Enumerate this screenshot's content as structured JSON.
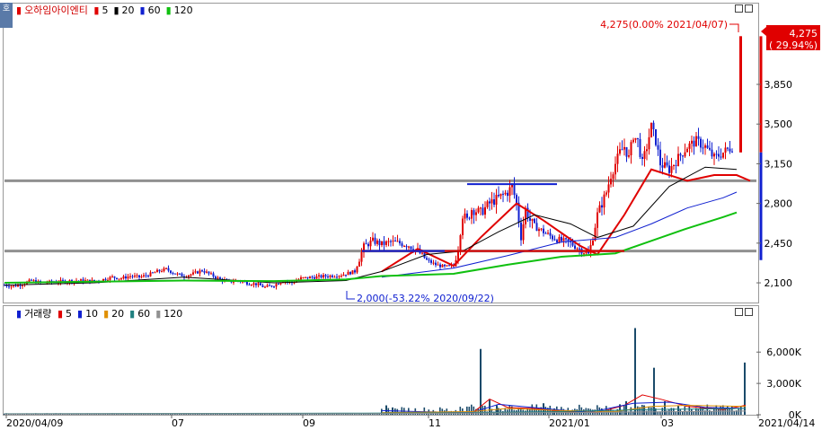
{
  "legend_price": {
    "name": "오하임아이엔티",
    "items": [
      {
        "label": "5",
        "color": "#e00000"
      },
      {
        "label": "20",
        "color": "#000000"
      },
      {
        "label": "60",
        "color": "#1020d0"
      },
      {
        "label": "120",
        "color": "#10c010"
      }
    ]
  },
  "legend_volume": {
    "name": "거래량",
    "items": [
      {
        "label": "5",
        "color": "#e00000"
      },
      {
        "label": "10",
        "color": "#1020d0"
      },
      {
        "label": "20",
        "color": "#e09000"
      },
      {
        "label": "60",
        "color": "#208080"
      },
      {
        "label": "120",
        "color": "#909090"
      }
    ]
  },
  "badge": "호",
  "chart_data": [
    {
      "type": "candlestick",
      "ylim": [
        1950,
        4420
      ],
      "y_ticks": [
        {
          "v": 2100,
          "label": "2,100"
        },
        {
          "v": 2450,
          "label": "2,450"
        },
        {
          "v": 2800,
          "label": "2,800"
        },
        {
          "v": 3150,
          "label": "3,150"
        },
        {
          "v": 3500,
          "label": "3,500"
        },
        {
          "v": 3850,
          "label": "3,850"
        }
      ],
      "last_price": {
        "label": "4,275",
        "pct": "( 29.94%)",
        "value": 4275
      },
      "annotation_high": {
        "text": "4,275(0.00% 2021/04/07)",
        "value": 4275
      },
      "annotation_low": {
        "text": "2,000(-53.22% 2020/09/22)",
        "value": 2000
      },
      "horizontal_lines": [
        {
          "value": 3000,
          "color": "#909090"
        },
        {
          "value": 2380,
          "color": "#909090"
        }
      ],
      "ohlc_path": [
        [
          0,
          2080
        ],
        [
          10,
          2070
        ],
        [
          20,
          2090
        ],
        [
          30,
          2120
        ],
        [
          40,
          2100
        ],
        [
          60,
          2110
        ],
        [
          80,
          2120
        ],
        [
          100,
          2115
        ],
        [
          110,
          2130
        ],
        [
          120,
          2150
        ],
        [
          130,
          2140
        ],
        [
          140,
          2160
        ],
        [
          150,
          2150
        ],
        [
          160,
          2170
        ],
        [
          170,
          2200
        ],
        [
          180,
          2220
        ],
        [
          190,
          2180
        ],
        [
          200,
          2160
        ],
        [
          210,
          2180
        ],
        [
          220,
          2210
        ],
        [
          230,
          2170
        ],
        [
          240,
          2130
        ],
        [
          250,
          2110
        ],
        [
          260,
          2120
        ],
        [
          270,
          2100
        ],
        [
          280,
          2090
        ],
        [
          290,
          2060
        ],
        [
          300,
          2080
        ],
        [
          310,
          2120
        ],
        [
          320,
          2100
        ],
        [
          330,
          2140
        ],
        [
          345,
          2150
        ],
        [
          360,
          2160
        ],
        [
          375,
          2170
        ],
        [
          390,
          2200
        ],
        [
          400,
          2420
        ],
        [
          410,
          2470
        ],
        [
          420,
          2440
        ],
        [
          430,
          2460
        ],
        [
          440,
          2450
        ],
        [
          450,
          2430
        ],
        [
          460,
          2380
        ],
        [
          470,
          2300
        ],
        [
          480,
          2260
        ],
        [
          490,
          2240
        ],
        [
          500,
          2250
        ],
        [
          505,
          2400
        ],
        [
          510,
          2700
        ],
        [
          515,
          2650
        ],
        [
          520,
          2750
        ],
        [
          530,
          2720
        ],
        [
          540,
          2800
        ],
        [
          550,
          2850
        ],
        [
          560,
          2900
        ],
        [
          565,
          2950
        ],
        [
          570,
          2800
        ],
        [
          575,
          2500
        ],
        [
          580,
          2750
        ],
        [
          585,
          2650
        ],
        [
          590,
          2600
        ],
        [
          600,
          2550
        ],
        [
          610,
          2500
        ],
        [
          620,
          2470
        ],
        [
          630,
          2450
        ],
        [
          640,
          2400
        ],
        [
          650,
          2350
        ],
        [
          655,
          2500
        ],
        [
          660,
          2700
        ],
        [
          665,
          2800
        ],
        [
          670,
          2900
        ],
        [
          675,
          3050
        ],
        [
          680,
          3150
        ],
        [
          685,
          3250
        ],
        [
          690,
          3300
        ],
        [
          695,
          3200
        ],
        [
          700,
          3400
        ],
        [
          705,
          3350
        ],
        [
          710,
          3150
        ],
        [
          715,
          3300
        ],
        [
          720,
          3480
        ],
        [
          725,
          3350
        ],
        [
          730,
          3150
        ],
        [
          740,
          3100
        ],
        [
          750,
          3200
        ],
        [
          760,
          3300
        ],
        [
          770,
          3350
        ],
        [
          780,
          3300
        ],
        [
          790,
          3200
        ],
        [
          800,
          3250
        ],
        [
          810,
          3300
        ],
        [
          815,
          4275
        ]
      ],
      "ma": [
        {
          "period": 5,
          "color": "#e00000",
          "points": [
            [
              420,
              2200
            ],
            [
              460,
              2400
            ],
            [
              500,
              2250
            ],
            [
              530,
              2500
            ],
            [
              570,
              2800
            ],
            [
              600,
              2650
            ],
            [
              640,
              2430
            ],
            [
              660,
              2350
            ],
            [
              690,
              2700
            ],
            [
              720,
              3100
            ],
            [
              760,
              3000
            ],
            [
              790,
              3050
            ],
            [
              815,
              3050
            ],
            [
              830,
              3000
            ]
          ]
        },
        {
          "period": 20,
          "color": "#000000",
          "points": [
            [
              0,
              2080
            ],
            [
              100,
              2100
            ],
            [
              200,
              2150
            ],
            [
              300,
              2100
            ],
            [
              380,
              2120
            ],
            [
              420,
              2200
            ],
            [
              470,
              2350
            ],
            [
              510,
              2380
            ],
            [
              550,
              2550
            ],
            [
              590,
              2700
            ],
            [
              630,
              2620
            ],
            [
              660,
              2500
            ],
            [
              700,
              2600
            ],
            [
              740,
              2950
            ],
            [
              780,
              3120
            ],
            [
              815,
              3100
            ]
          ]
        },
        {
          "period": 60,
          "color": "#1020d0",
          "points": [
            [
              420,
              2150
            ],
            [
              500,
              2230
            ],
            [
              560,
              2340
            ],
            [
              620,
              2460
            ],
            [
              680,
              2500
            ],
            [
              720,
              2620
            ],
            [
              760,
              2760
            ],
            [
              800,
              2850
            ],
            [
              815,
              2900
            ]
          ]
        },
        {
          "period": 120,
          "color": "#10c010",
          "points": [
            [
              0,
              2100
            ],
            [
              100,
              2110
            ],
            [
              200,
              2120
            ],
            [
              300,
              2115
            ],
            [
              380,
              2130
            ],
            [
              420,
              2160
            ],
            [
              500,
              2180
            ],
            [
              560,
              2260
            ],
            [
              620,
              2330
            ],
            [
              680,
              2360
            ],
            [
              720,
              2470
            ],
            [
              760,
              2580
            ],
            [
              800,
              2680
            ],
            [
              815,
              2720
            ]
          ]
        }
      ],
      "trend_lines": [
        {
          "color": "#e00000",
          "points": [
            [
              398,
              2380
            ],
            [
              690,
              2380
            ]
          ]
        },
        {
          "color": "#1020d0",
          "points": [
            [
              398,
              2380
            ],
            [
              490,
              2380
            ]
          ]
        },
        {
          "color": "#1020d0",
          "points": [
            [
              515,
              2970
            ],
            [
              615,
              2970
            ]
          ]
        }
      ]
    },
    {
      "type": "bar",
      "ylim": [
        0,
        9200
      ],
      "y_ticks": [
        {
          "v": 0,
          "label": "0K"
        },
        {
          "v": 3000,
          "label": "3,000K"
        },
        {
          "v": 6000,
          "label": "6,000K"
        }
      ],
      "spikes": [
        [
          425,
          900
        ],
        [
          432,
          700
        ],
        [
          530,
          6300
        ],
        [
          540,
          1500
        ],
        [
          548,
          900
        ],
        [
          600,
          1100
        ],
        [
          612,
          600
        ],
        [
          685,
          1000
        ],
        [
          692,
          1300
        ],
        [
          702,
          8300
        ],
        [
          712,
          900
        ],
        [
          723,
          4500
        ],
        [
          735,
          1300
        ],
        [
          750,
          900
        ],
        [
          824,
          5000
        ]
      ],
      "base_level": 150,
      "ma": [
        {
          "period": 5,
          "color": "#e00000",
          "points": [
            [
              520,
              100
            ],
            [
              540,
              1500
            ],
            [
              560,
              700
            ],
            [
              590,
              600
            ],
            [
              620,
              300
            ],
            [
              660,
              200
            ],
            [
              690,
              900
            ],
            [
              710,
              1900
            ],
            [
              730,
              1500
            ],
            [
              760,
              800
            ],
            [
              800,
              500
            ],
            [
              825,
              900
            ]
          ]
        },
        {
          "period": 10,
          "color": "#1020d0",
          "points": [
            [
              420,
              400
            ],
            [
              460,
              300
            ],
            [
              520,
              200
            ],
            [
              550,
              1000
            ],
            [
              600,
              600
            ],
            [
              650,
              200
            ],
            [
              700,
              1100
            ],
            [
              740,
              1200
            ],
            [
              780,
              700
            ],
            [
              825,
              600
            ]
          ]
        },
        {
          "period": 20,
          "color": "#e09000",
          "points": [
            [
              420,
              200
            ],
            [
              520,
              300
            ],
            [
              560,
              600
            ],
            [
              620,
              400
            ],
            [
              680,
              300
            ],
            [
              720,
              800
            ],
            [
              760,
              900
            ],
            [
              825,
              800
            ]
          ]
        },
        {
          "period": 60,
          "color": "#208080",
          "points": [
            [
              0,
              100
            ],
            [
              400,
              150
            ],
            [
              520,
              200
            ],
            [
              620,
              300
            ],
            [
              720,
              500
            ],
            [
              825,
              600
            ]
          ]
        },
        {
          "period": 120,
          "color": "#909090",
          "points": [
            [
              0,
              80
            ],
            [
              400,
              100
            ],
            [
              620,
              200
            ],
            [
              825,
              350
            ]
          ]
        }
      ]
    }
  ],
  "x_axis": {
    "ticks": [
      {
        "x": 7,
        "label": "2020/04/09"
      },
      {
        "x": 191,
        "label": "07"
      },
      {
        "x": 337,
        "label": "09"
      },
      {
        "x": 477,
        "label": "11"
      },
      {
        "x": 611,
        "label": "2021/01"
      },
      {
        "x": 736,
        "label": "03"
      },
      {
        "x": 844,
        "label": "2021/04/14"
      }
    ]
  }
}
